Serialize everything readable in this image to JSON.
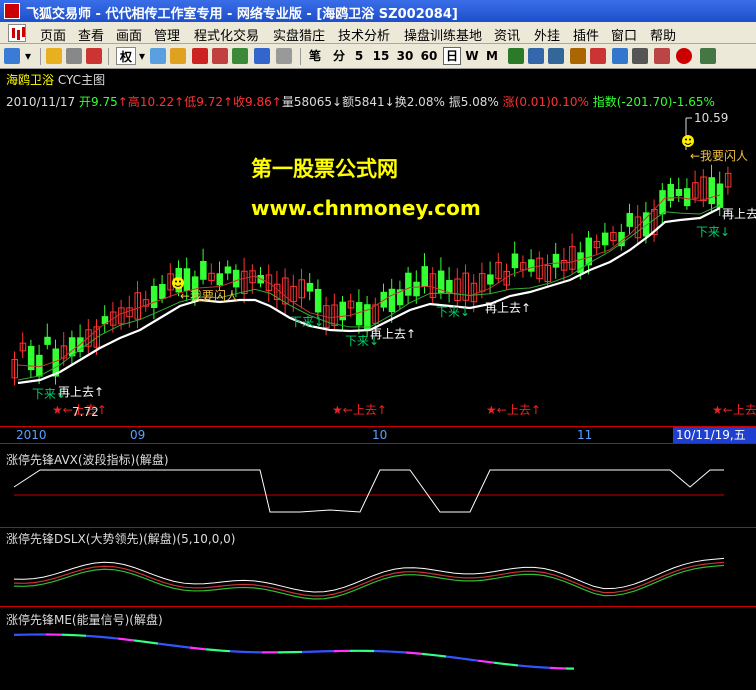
{
  "window": {
    "title": "飞狐交易师 - 代代相传工作室专用 - 网络专业版 - [海鸥卫浴 SZ002084]"
  },
  "menu": {
    "items": [
      "页面",
      "查看",
      "画面",
      "管理",
      "程式化交易",
      "实盘猎庄",
      "技术分析",
      "操盘训练基地",
      "资讯",
      "外挂",
      "插件",
      "窗口",
      "帮助"
    ]
  },
  "toolbar": {
    "weight_label": "权",
    "period_labels": [
      "笔",
      "分",
      "5",
      "15",
      "30",
      "60",
      "日",
      "W",
      "M"
    ],
    "icons": [
      "layout-icon",
      "dropdown-icon",
      "weight-icon",
      "pen-icon",
      "draw-icon",
      "scissor-icon",
      "f10-icon",
      "pdf-icon",
      "sheet-icon",
      "pin-icon",
      "hand-icon",
      "filter-icon",
      "zoom-in-icon",
      "zoom-out-icon",
      "pencil-icon",
      "grid-icon",
      "ruler-icon",
      "cross-icon",
      "window-icon",
      "ban-icon",
      "scope-icon"
    ]
  },
  "chart": {
    "panel_title": "海鸥卫浴",
    "panel_subtitle": "CYC主图",
    "quote": {
      "date": "2010/11/17",
      "open_label": "开",
      "open": "9.75",
      "high_label": "高",
      "high": "10.22",
      "low_label": "低",
      "low": "9.72",
      "close_label": "收",
      "close": "9.86",
      "volume_label": "量",
      "volume": "58065",
      "amount_label": "额",
      "amount": "5841",
      "turnover_label": "换",
      "turnover": "2.08%",
      "amplitude_label": "振",
      "amplitude": "5.08%",
      "change_label": "涨",
      "change": "(0.01)",
      "change_pct": "0.10%",
      "index_label": "指数",
      "index": "(-201.70)",
      "index_pct": "-1.65%"
    },
    "high_value_label": "10.59",
    "low_value_label": "7.72",
    "watermark_line1": "第一股票公式网",
    "watermark_line2": "www.chnmoney.com",
    "annotations": [
      {
        "text": "←我要闪人",
        "color": "#f0c040"
      },
      {
        "text": "←我要闪人",
        "color": "#f0c040"
      },
      {
        "text": "再上去↑",
        "color": "#ffffff"
      },
      {
        "text": "再上去↑",
        "color": "#ffffff"
      },
      {
        "text": "再上去↑",
        "color": "#ffffff"
      },
      {
        "text": "再上去",
        "color": "#ffffff"
      },
      {
        "text": "下来↓",
        "color": "#00cc66"
      },
      {
        "text": "下来↓",
        "color": "#00cc66"
      },
      {
        "text": "下来↓",
        "color": "#00cc66"
      },
      {
        "text": "下来↓",
        "color": "#00cc66"
      },
      {
        "text": "下来↓",
        "color": "#00cc66"
      },
      {
        "text": "★←上去↑",
        "color": "#ee2222"
      },
      {
        "text": "★←上去↑",
        "color": "#ee2222"
      },
      {
        "text": "★←上去↑",
        "color": "#ee2222"
      },
      {
        "text": "★←上去",
        "color": "#ee2222"
      }
    ],
    "colors": {
      "up": "#ff3333",
      "down": "#33ff33",
      "ma_main": "#ffffff",
      "accent_yellow": "#ffff00",
      "axis_red": "#cc0000"
    }
  },
  "time_axis": {
    "labels": [
      "2010",
      "09",
      "10",
      "11"
    ],
    "cursor_label": "10/11/19,五"
  },
  "indicators": {
    "avx_title": "涨停先锋AVX(波段指标)(解盘)",
    "dslx_title": "涨停先锋DSLX(大势领先)(解盘)(5,10,0,0)",
    "me_title": "涨停先锋ME(能量信号)(解盘)"
  }
}
